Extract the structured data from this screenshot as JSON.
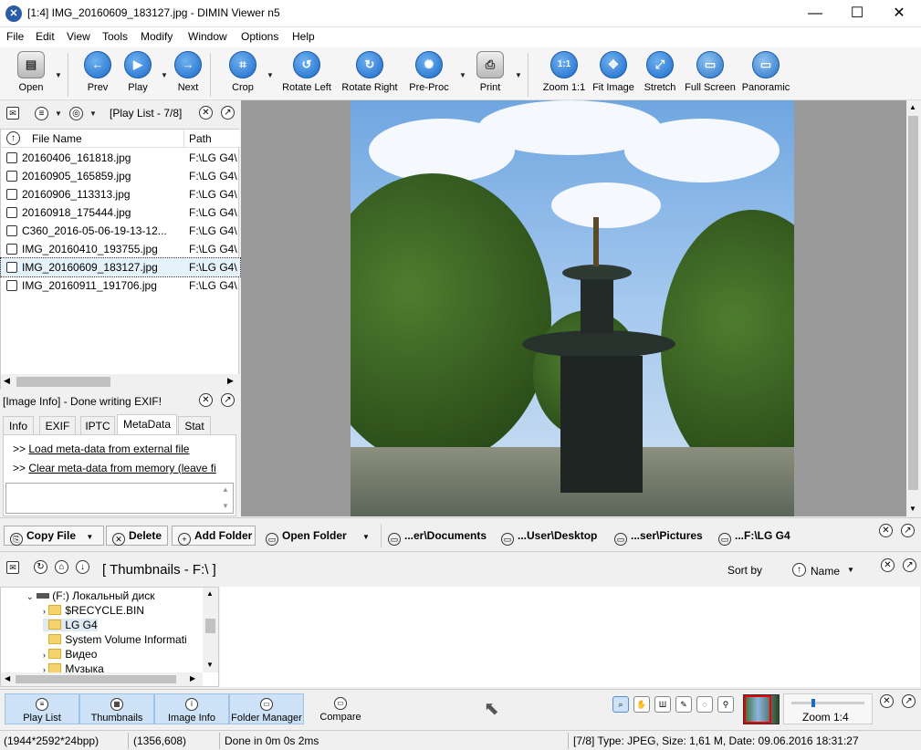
{
  "window": {
    "title": "[1:4] IMG_20160609_183127.jpg - DIMIN Viewer n5",
    "icon": "app-logo-icon",
    "minimize": "—",
    "maximize": "☐",
    "close": "✕"
  },
  "menu": [
    "File",
    "Edit",
    "View",
    "Tools",
    "Modify",
    "Window",
    "Options",
    "Help"
  ],
  "toolbar": {
    "open": "Open",
    "prev": "Prev",
    "play": "Play",
    "next": "Next",
    "crop": "Crop",
    "rotate_left": "Rotate Left",
    "rotate_right": "Rotate Right",
    "preproc": "Pre-Proc",
    "print": "Print",
    "zoom11": "Zoom 1:1",
    "zoom11_glyph": "1:1",
    "fit_image": "Fit Image",
    "stretch": "Stretch",
    "full_screen": "Full Screen",
    "panoramic": "Panoramic"
  },
  "playlist": {
    "title": "[Play List - 7/8]",
    "col_name": "File Name",
    "col_path": "Path",
    "items": [
      {
        "name": "20160406_161818.jpg",
        "path": "F:\\LG G4\\"
      },
      {
        "name": "20160905_165859.jpg",
        "path": "F:\\LG G4\\"
      },
      {
        "name": "20160906_113313.jpg",
        "path": "F:\\LG G4\\"
      },
      {
        "name": "20160918_175444.jpg",
        "path": "F:\\LG G4\\"
      },
      {
        "name": "C360_2016-05-06-19-13-12...",
        "path": "F:\\LG G4\\"
      },
      {
        "name": "IMG_20160410_193755.jpg",
        "path": "F:\\LG G4\\"
      },
      {
        "name": "IMG_20160609_183127.jpg",
        "path": "F:\\LG G4\\"
      },
      {
        "name": "IMG_20160911_191706.jpg",
        "path": "F:\\LG G4\\"
      }
    ],
    "selected_index": 6
  },
  "image_info": {
    "title": "[Image Info] - Done writing EXIF!",
    "tabs": [
      "Info",
      "EXIF",
      "IPTC",
      "MetaData",
      "Stat"
    ],
    "active_tab": "MetaData",
    "link_prefix": ">>",
    "link1": "Load meta-data from external file",
    "link2": "Clear meta-data from memory (leave fi"
  },
  "filebar": {
    "copy_file": "Copy File",
    "delete": "Delete",
    "add_folder": "Add Folder",
    "open_folder": "Open Folder",
    "shortcuts": [
      "...er\\Documents",
      "...User\\Desktop",
      "...ser\\Pictures",
      "...F:\\LG G4"
    ]
  },
  "thumbnails": {
    "title": "[ Thumbnails - F:\\ ]",
    "sort_label": "Sort by",
    "sort_value": "Name",
    "tree": {
      "drive": "(F:)  Локальный диск",
      "folders": [
        "$RECYCLE.BIN",
        "LG G4",
        "System Volume Informati",
        "Видео",
        "Музыка"
      ],
      "selected": "LG G4"
    }
  },
  "bottom": {
    "play_list": "Play List",
    "thumbnails": "Thumbnails",
    "image_info": "Image Info",
    "folder_manager": "Folder Manager",
    "compare": "Compare",
    "zoom": "Zoom 1:4"
  },
  "status": {
    "dims": "(1944*2592*24bpp)",
    "coords": "(1356,608)",
    "done": "Done in 0m 0s 2ms",
    "info": "[7/8] Type: JPEG, Size: 1,61 M, Date: 09.06.2016 18:31:27"
  }
}
